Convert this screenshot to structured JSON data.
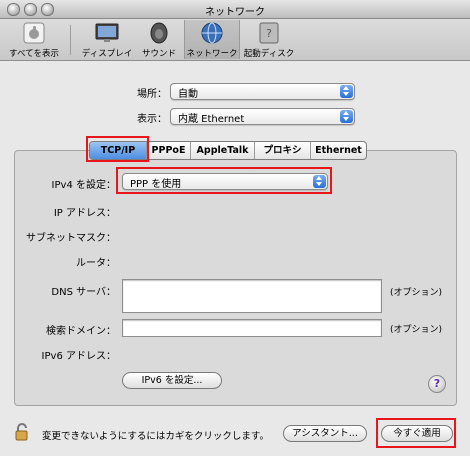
{
  "window": {
    "title": "ネットワーク"
  },
  "toolbar": {
    "items": [
      {
        "label": "すべてを表示",
        "icon": "apple-grid-icon"
      },
      {
        "label": "ディスプレイ",
        "icon": "display-icon"
      },
      {
        "label": "サウンド",
        "icon": "speaker-icon"
      },
      {
        "label": "ネットワーク",
        "icon": "network-globe-icon"
      },
      {
        "label": "起動ディスク",
        "icon": "startup-disk-icon"
      }
    ]
  },
  "location": {
    "label": "場所：",
    "value": "自動"
  },
  "show": {
    "label": "表示：",
    "value": "内蔵 Ethernet"
  },
  "tabs": [
    "TCP/IP",
    "PPPoE",
    "AppleTalk",
    "プロキシ",
    "Ethernet"
  ],
  "form": {
    "ipv4_label": "IPv4 を設定：",
    "ipv4_value": "PPP を使用",
    "ip_label": "IP アドレス：",
    "subnet_label": "サブネットマスク：",
    "router_label": "ルータ：",
    "dns_label": "DNS サーバ：",
    "dns_option": "(オプション)",
    "search_label": "検索ドメイン：",
    "search_option": "(オプション)",
    "ipv6_label": "IPv6 アドレス：",
    "ipv6_button": "IPv6 を設定..."
  },
  "footer": {
    "lock_text": "変更できないようにするにはカギをクリックします。",
    "assistant_button": "アシスタント...",
    "apply_button": "今すぐ適用"
  },
  "colors": {
    "highlight": "#e8161b",
    "accent": "#4d8ee2"
  }
}
